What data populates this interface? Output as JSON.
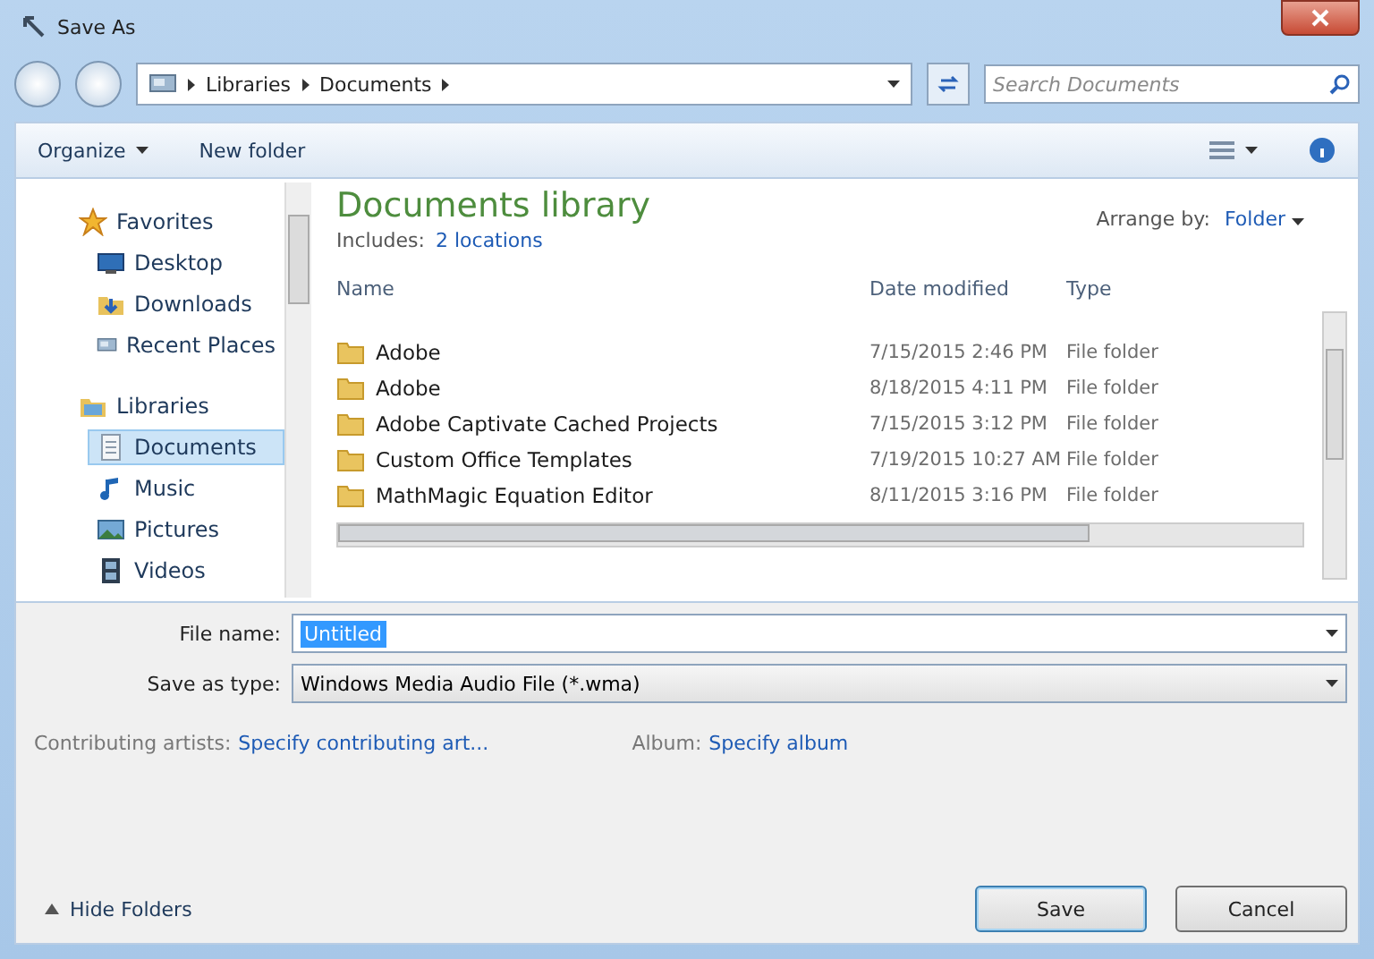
{
  "window": {
    "title": "Save As"
  },
  "address": {
    "path": [
      "Libraries",
      "Documents"
    ]
  },
  "search": {
    "placeholder": "Search Documents"
  },
  "toolbar": {
    "organize": "Organize",
    "new_folder": "New folder"
  },
  "nav_tree": [
    {
      "label": "Favorites",
      "kind": "star",
      "children": [
        {
          "label": "Desktop",
          "kind": "desktop",
          "selected": false
        },
        {
          "label": "Downloads",
          "kind": "downloads",
          "selected": false
        },
        {
          "label": "Recent Places",
          "kind": "recent",
          "selected": false
        }
      ]
    },
    {
      "label": "Libraries",
      "kind": "library",
      "children": [
        {
          "label": "Documents",
          "kind": "documents",
          "selected": true
        },
        {
          "label": "Music",
          "kind": "music",
          "selected": false
        },
        {
          "label": "Pictures",
          "kind": "pictures",
          "selected": false
        },
        {
          "label": "Videos",
          "kind": "videos",
          "selected": false
        }
      ]
    }
  ],
  "library": {
    "title": "Documents library",
    "includes_label": "Includes:",
    "includes_link": "2 locations",
    "arrange_label": "Arrange by:",
    "arrange_value": "Folder"
  },
  "file_list": {
    "columns": [
      "Name",
      "Date modified",
      "Type"
    ],
    "rows": [
      {
        "name": "Adobe",
        "date": "7/15/2015 2:46 PM",
        "type": "File folder"
      },
      {
        "name": "Adobe",
        "date": "8/18/2015 4:11 PM",
        "type": "File folder"
      },
      {
        "name": "Adobe Captivate Cached Projects",
        "date": "7/15/2015 3:12 PM",
        "type": "File folder"
      },
      {
        "name": "Custom Office Templates",
        "date": "7/19/2015 10:27 AM",
        "type": "File folder"
      },
      {
        "name": "MathMagic Equation Editor",
        "date": "8/11/2015 3:16 PM",
        "type": "File folder"
      }
    ]
  },
  "file_name": {
    "label": "File name:",
    "value": "Untitled"
  },
  "save_type": {
    "label": "Save as type:",
    "value": "Windows Media Audio File (*.wma)"
  },
  "metadata": [
    {
      "label": "Contributing artists:",
      "link": "Specify contributing art..."
    },
    {
      "label": "Album:",
      "link": "Specify album"
    }
  ],
  "hide_folders": "Hide Folders",
  "buttons": [
    {
      "label": "Save",
      "default": true
    },
    {
      "label": "Cancel",
      "default": false
    }
  ]
}
